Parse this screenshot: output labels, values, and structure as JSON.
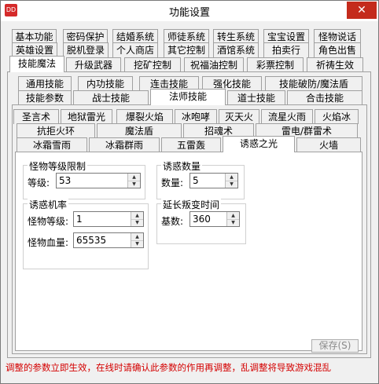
{
  "window": {
    "title": "功能设置",
    "close_glyph": "✕",
    "icon_text": "DD"
  },
  "tabs_row1": [
    "基本功能",
    "密码保护",
    "结婚系统",
    "师徒系统",
    "转生系统",
    "宝宝设置",
    "怪物说话"
  ],
  "tabs_row2": [
    "英雄设置",
    "脱机登录",
    "个人商店",
    "其它控制",
    "酒馆系统",
    "拍卖行",
    "角色出售"
  ],
  "tabs_row3": [
    "技能魔法",
    "升级武器",
    "挖矿控制",
    "祝福油控制",
    "彩票控制",
    "祈祷生效"
  ],
  "skill_tabs_row1": [
    "通用技能",
    "内功技能",
    "连击技能",
    "强化技能",
    "技能破防/魔法盾"
  ],
  "skill_tabs_row2": [
    "技能参数",
    "战士技能",
    "法师技能",
    "道士技能",
    "合击技能"
  ],
  "mage_tabs_row1": [
    "圣言术",
    "地狱雷光",
    "爆裂火焰",
    "冰咆哮",
    "灭天火",
    "流星火雨",
    "火焰冰"
  ],
  "mage_tabs_row2": [
    "抗拒火环",
    "魔法盾",
    "招魂术",
    "雷电/群雷术"
  ],
  "mage_tabs_row3": [
    "冰霜雪雨",
    "冰霜群雨",
    "五雷轰",
    "诱惑之光",
    "火墙"
  ],
  "group_level_limit": {
    "title": "怪物等级限制",
    "level_label": "等级:",
    "level_value": "53"
  },
  "group_tempt_count": {
    "title": "诱惑数量",
    "count_label": "数量:",
    "count_value": "5"
  },
  "group_tempt_rate": {
    "title": "诱惑机率",
    "monster_level_label": "怪物等级:",
    "monster_level_value": "1",
    "monster_hp_label": "怪物血量:",
    "monster_hp_value": "65535"
  },
  "group_extend": {
    "title": "延长叛变时间",
    "base_label": "基数:",
    "base_value": "360"
  },
  "save_label": "保存(S)",
  "warning": "调整的参数立即生效，在线时请确认此参数的作用再调整，乱调整将导致游戏混乱",
  "colors": {
    "close_bg": "#c42b1c",
    "warning_text": "#d40000",
    "panel_bg": "#f0f0f0"
  }
}
